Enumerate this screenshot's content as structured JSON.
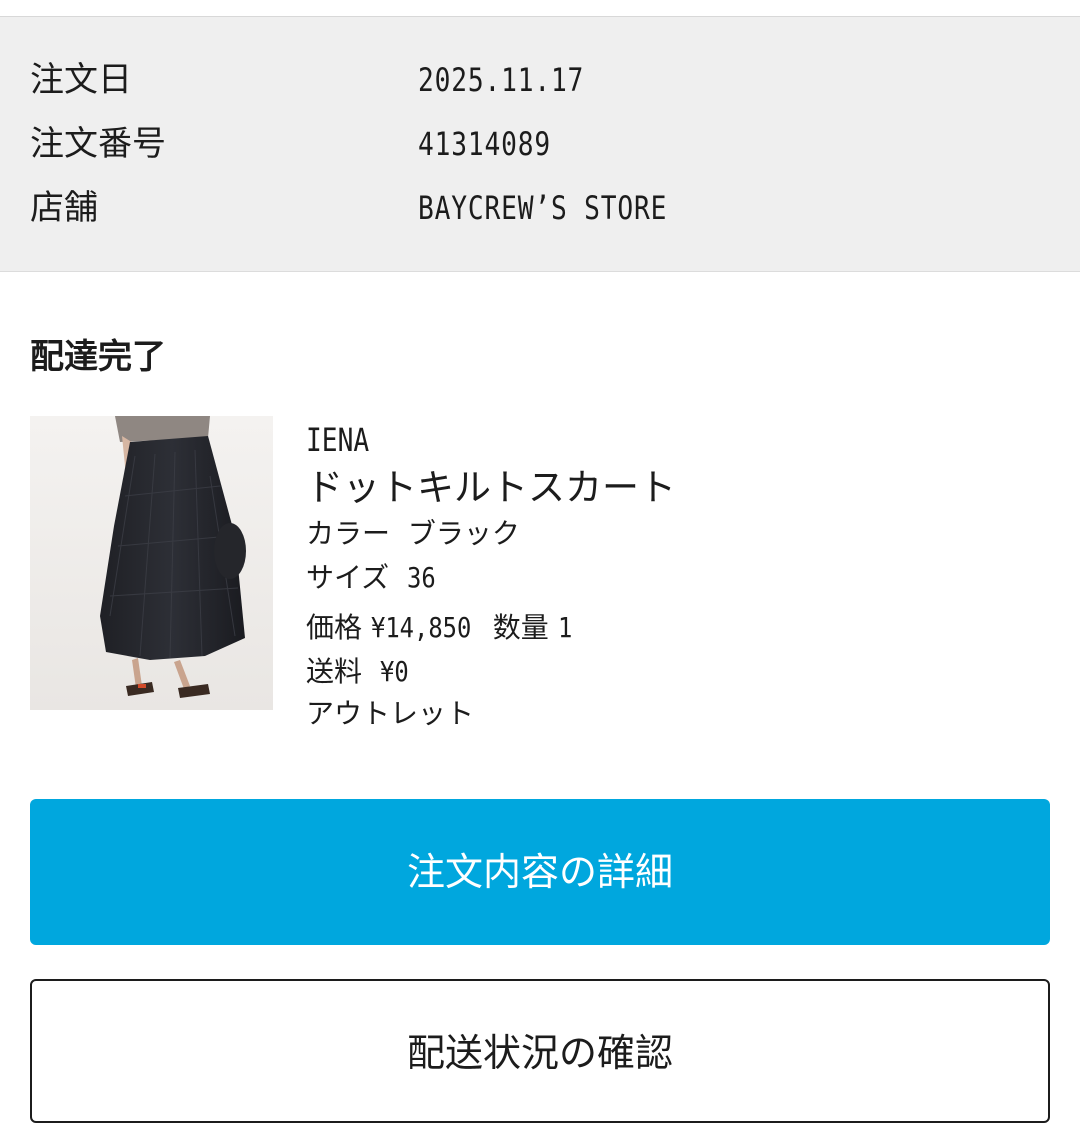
{
  "order_info": {
    "date_label": "注文日",
    "date_value": "2025.11.17",
    "number_label": "注文番号",
    "number_value": "41314089",
    "store_label": "店舗",
    "store_value": "BAYCREW’S STORE"
  },
  "status": "配達完了",
  "product": {
    "image_icon": "skirt-product-photo",
    "brand": "IENA",
    "name": "ドットキルトスカート",
    "color_label": "カラー",
    "color_value": "ブラック",
    "size_label": "サイズ",
    "size_value": "36",
    "price_label": "価格",
    "price_value": "¥14,850",
    "qty_label": "数量",
    "qty_value": "1",
    "shipping_label": "送料",
    "shipping_value": "¥0",
    "note": "アウトレット"
  },
  "buttons": {
    "order_detail": "注文内容の詳細",
    "shipping_status": "配送状況の確認"
  },
  "colors": {
    "accent": "#00a7de",
    "panel_bg": "#efefef"
  }
}
